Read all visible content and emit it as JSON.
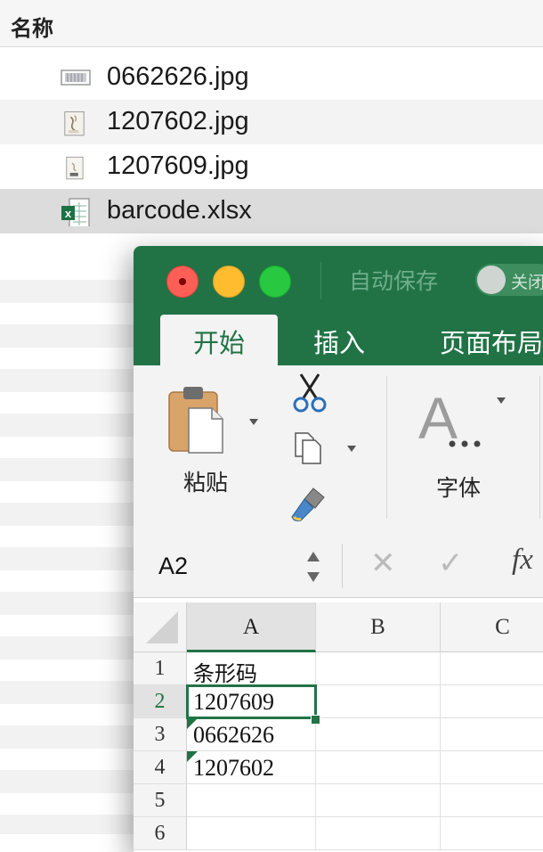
{
  "finder": {
    "header_label": "名称",
    "files": [
      {
        "name": "0662626.jpg",
        "icon": "barcode-image-icon",
        "state": "normal"
      },
      {
        "name": "1207602.jpg",
        "icon": "image-thumbnail-icon",
        "state": "alt"
      },
      {
        "name": "1207609.jpg",
        "icon": "image-thumbnail-icon",
        "state": "normal"
      },
      {
        "name": "barcode.xlsx",
        "icon": "excel-file-icon",
        "state": "selected"
      }
    ]
  },
  "excel": {
    "autosave_label": "自动保存",
    "autosave_toggle_label": "关闭",
    "tabs": [
      "开始",
      "插入",
      "页面布局"
    ],
    "active_tab": "开始",
    "ribbon": {
      "paste_label": "粘贴",
      "font_label": "字体"
    },
    "name_box": "A2",
    "fx_label": "fx",
    "columns": [
      "A",
      "B",
      "C"
    ],
    "rows": [
      "1",
      "2",
      "3",
      "4",
      "5",
      "6"
    ],
    "cells_a": [
      "条形码",
      "1207609",
      "0662626",
      "1207602",
      "",
      ""
    ],
    "active_cell": "A2"
  },
  "colors": {
    "excel_green": "#217346",
    "selection_gray": "#dcdcdc"
  }
}
